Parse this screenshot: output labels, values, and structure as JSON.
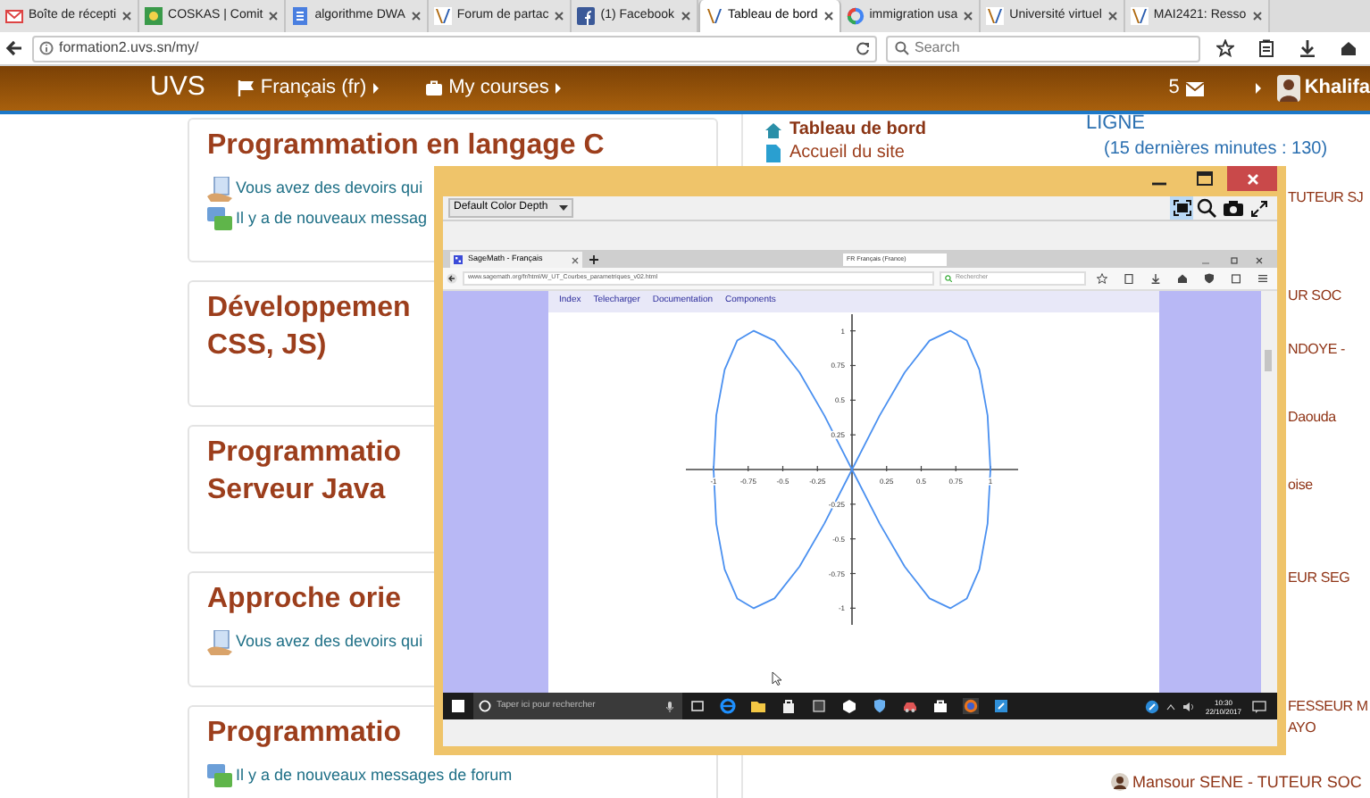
{
  "browser": {
    "tabs": [
      {
        "label": "Boîte de récepti",
        "kind": "mail",
        "selected": false
      },
      {
        "label": "COSKAS | Comit",
        "kind": "image",
        "selected": false
      },
      {
        "label": "algorithme DWA",
        "kind": "doc",
        "selected": false
      },
      {
        "label": "Forum de partac",
        "kind": "site",
        "selected": false
      },
      {
        "label": "(1) Facebook",
        "kind": "facebook",
        "selected": false
      },
      {
        "label": "Tableau de bord",
        "kind": "site",
        "selected": true
      },
      {
        "label": "immigration usa",
        "kind": "google",
        "selected": false
      },
      {
        "label": "Université virtuel",
        "kind": "site",
        "selected": false
      },
      {
        "label": "MAI2421: Resso",
        "kind": "site",
        "selected": false
      }
    ],
    "url": "formation2.uvs.sn/my/",
    "search": {
      "placeholder": "Search"
    }
  },
  "navbar": {
    "brand": "UVS",
    "language": "Français (fr)",
    "courses": "My courses",
    "messages_count": "5",
    "user": "Khalifa"
  },
  "courses": [
    {
      "title_lines": [
        "Programmation en langage C"
      ],
      "notices": [
        {
          "kind": "assignment",
          "text": "Vous avez des devoirs qui"
        },
        {
          "kind": "forum",
          "text": "Il y a de nouveaux messag"
        }
      ]
    },
    {
      "title_lines": [
        "Développemen",
        "CSS, JS)"
      ]
    },
    {
      "title_lines": [
        "Programmatio",
        "Serveur Java"
      ]
    },
    {
      "title_lines": [
        "Approche orie"
      ],
      "notices": [
        {
          "kind": "assignment",
          "text": "Vous avez des devoirs qui"
        }
      ]
    },
    {
      "title_lines": [
        "Programmatio"
      ],
      "notices": [
        {
          "kind": "forum",
          "text": "Il y a de nouveaux messages de forum"
        }
      ]
    }
  ],
  "navigation": {
    "items": [
      {
        "label": "Tableau de bord",
        "kind": "home",
        "selected": true
      },
      {
        "label": "Accueil du site",
        "kind": "page",
        "selected": false
      }
    ]
  },
  "online_users": {
    "heading": "LIGNE",
    "subtitle": "(15 dernières minutes : 130)",
    "users": [
      {
        "kind": "partial",
        "lines": [
          "TUTEUR SJ"
        ]
      },
      {
        "kind": "partial",
        "lines": [
          "UR SOC"
        ]
      },
      {
        "kind": "partial",
        "lines": [
          "NDOYE -"
        ]
      },
      {
        "kind": "partial",
        "lines": [
          "Daouda"
        ]
      },
      {
        "kind": "partial",
        "lines": [
          "oise"
        ]
      },
      {
        "kind": "partial",
        "lines": [
          "EUR SEG"
        ]
      },
      {
        "kind": "partial",
        "lines": [
          "FESSEUR M",
          "AYO"
        ]
      },
      {
        "kind": "full",
        "lines": [
          "Mansour SENE - TUTEUR SOC"
        ]
      }
    ]
  },
  "remote_window": {
    "color_depth": "Default Color Depth",
    "inner_browser": {
      "tab": "SageMath - Français",
      "language": "FR Français (France)",
      "url": "www.sagemath.org/fr/html/W_UT_Courbes_parametriques_v02.html",
      "search": {
        "placeholder": "Rechercher"
      },
      "nav": [
        "Index",
        "Telecharger",
        "Documentation",
        "Components"
      ],
      "chart_data": {
        "type": "line",
        "xlim": [
          -1.2,
          1.2
        ],
        "ylim": [
          -1.12,
          1.12
        ],
        "xticks": [
          -1,
          -0.75,
          -0.5,
          -0.25,
          0.25,
          0.5,
          0.75,
          1
        ],
        "yticks": [
          1,
          0.75,
          0.5,
          0.25,
          -0.25,
          -0.5,
          -0.75,
          -1
        ],
        "x": [
          -1,
          -0.98,
          -0.92,
          -0.83,
          -0.71,
          -0.56,
          -0.38,
          -0.2,
          0,
          0.2,
          0.38,
          0.56,
          0.71,
          0.83,
          0.92,
          0.98,
          1
        ],
        "series": [
          {
            "color": "#4a90f0",
            "values": [
              0,
              -0.39,
              -0.72,
              -0.93,
              -1,
              -0.93,
              -0.7,
              -0.39,
              0,
              0.39,
              0.7,
              0.93,
              1,
              0.93,
              0.72,
              0.39,
              0
            ]
          },
          {
            "color": "#4a90f0",
            "values": [
              0,
              0.39,
              0.72,
              0.93,
              1,
              0.93,
              0.7,
              0.39,
              0,
              -0.39,
              -0.7,
              -0.93,
              -1,
              -0.93,
              -0.72,
              -0.39,
              0
            ]
          }
        ]
      }
    },
    "taskbar": {
      "search": {
        "placeholder": "Taper ici pour rechercher"
      },
      "time": "10:30",
      "date": "22/10/2017"
    }
  }
}
